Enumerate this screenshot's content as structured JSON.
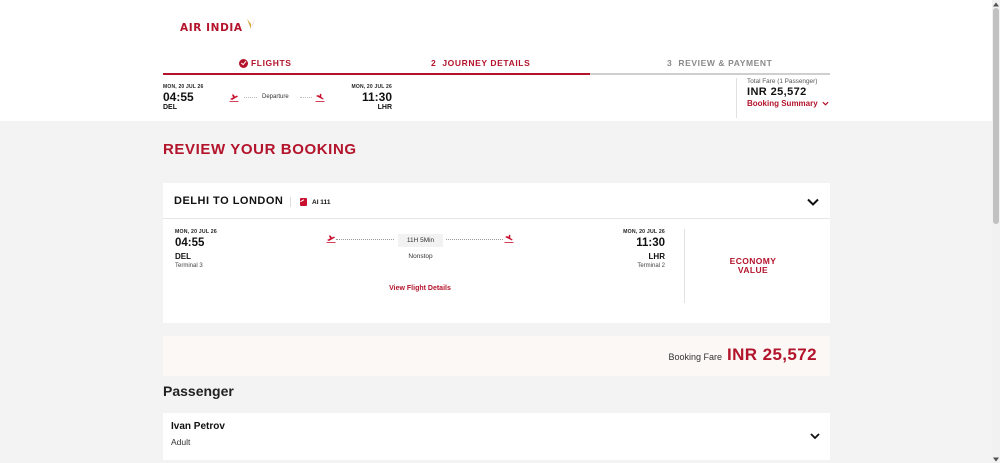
{
  "brand": {
    "name": "AIR INDIA",
    "accent": "#b3132b"
  },
  "steps": [
    {
      "number": "",
      "label": "Flights",
      "state": "completed"
    },
    {
      "number": "2",
      "label": "Journey Details",
      "state": "current"
    },
    {
      "number": "3",
      "label": "Review & Payment",
      "state": "upcoming"
    }
  ],
  "summary_bar": {
    "departure": {
      "date": "MON, 20 JUL 26",
      "time": "04:55",
      "code": "DEL"
    },
    "path_label": "Departure",
    "arrival": {
      "date": "MON, 20 JUL 26",
      "time": "11:30",
      "code": "LHR"
    },
    "fare": {
      "label": "Total Fare (1 Passenger)",
      "amount": "INR 25,572",
      "summary_link": "Booking Summary"
    }
  },
  "page_title": "Review Your Booking",
  "flight": {
    "route": "Delhi to London",
    "flight_number": "AI 111",
    "departure": {
      "date": "MON, 20 JUL 26",
      "time": "04:55",
      "code": "DEL",
      "terminal": "Terminal 3"
    },
    "arrival": {
      "date": "MON, 20 JUL 26",
      "time": "11:30",
      "code": "LHR",
      "terminal": "Terminal 2"
    },
    "duration": "11H 5Min",
    "stops": "Nonstop",
    "details_link": "View Flight Details",
    "fare_class_line1": "Economy",
    "fare_class_line2": "Value"
  },
  "booking_fare": {
    "label": "Booking Fare",
    "amount": "INR 25,572"
  },
  "passenger_section": {
    "title": "Passenger",
    "passengers": [
      {
        "name": "Ivan Petrov",
        "type": "Adult"
      }
    ]
  },
  "icons": {
    "takeoff": "plane-takeoff-icon",
    "landing": "plane-landing-icon",
    "chevron": "chevron-down-icon",
    "check": "check-circle-icon",
    "airline": "air-india-tail-icon"
  }
}
